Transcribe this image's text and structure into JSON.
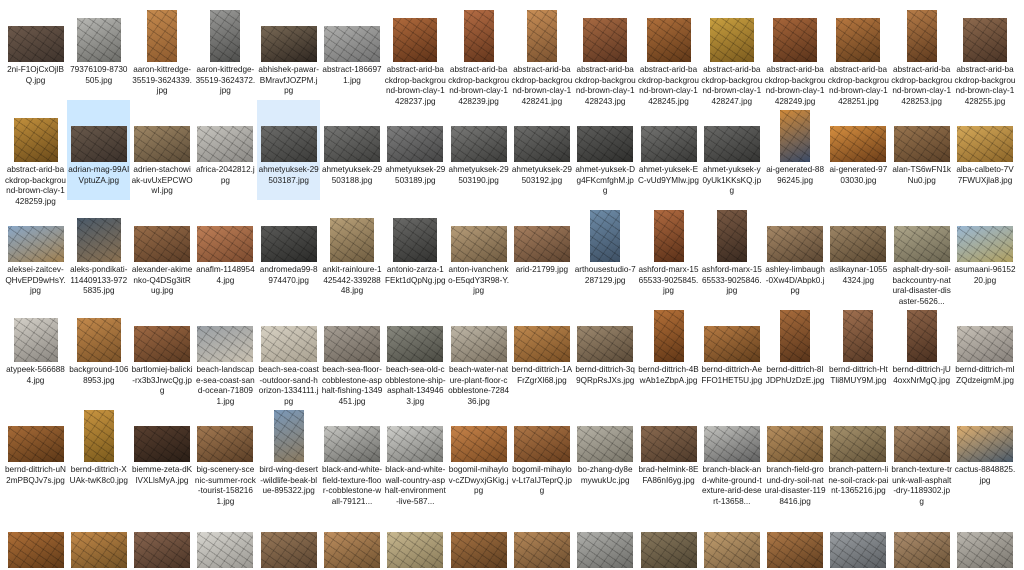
{
  "rows": [
    [
      {
        "label": "2ni-F1OjCxOjlBQ.jpg",
        "shape": "l",
        "c1": "#6e5a4c",
        "c2": "#3e332c"
      },
      {
        "label": "79376109-8730505.jpg",
        "shape": "s",
        "c1": "#b8b8b4",
        "c2": "#6c6c68"
      },
      {
        "label": "aaron-kittredge-35519-3624339.jpg",
        "shape": "p",
        "c1": "#c58a4e",
        "c2": "#8d5a2e"
      },
      {
        "label": "aaron-kittredge-35519-3624372.jpg",
        "shape": "p",
        "c1": "#9a9a98",
        "c2": "#4e4e4c"
      },
      {
        "label": "abhishek-pawar-BMravfJOZPM.jpg",
        "shape": "l",
        "c1": "#7a6a56",
        "c2": "#2e2620"
      },
      {
        "label": "abstract-1866971.jpg",
        "shape": "l",
        "c1": "#b0b0ae",
        "c2": "#707070"
      },
      {
        "label": "abstract-arid-backdrop-background-brown-clay-1428237.jpg",
        "shape": "s",
        "c1": "#b06a3c",
        "c2": "#5e3218"
      },
      {
        "label": "abstract-arid-backdrop-background-brown-clay-1428239.jpg",
        "shape": "p",
        "c1": "#b46c44",
        "c2": "#64361c"
      },
      {
        "label": "abstract-arid-backdrop-background-brown-clay-1428241.jpg",
        "shape": "p",
        "c1": "#c88e56",
        "c2": "#7a5230"
      },
      {
        "label": "abstract-arid-backdrop-background-brown-clay-1428243.jpg",
        "shape": "s",
        "c1": "#a86a42",
        "c2": "#5a3420"
      },
      {
        "label": "abstract-arid-backdrop-background-brown-clay-1428245.jpg",
        "shape": "s",
        "c1": "#b0703c",
        "c2": "#603818"
      },
      {
        "label": "abstract-arid-backdrop-background-brown-clay-1428247.jpg",
        "shape": "s",
        "c1": "#c9a040",
        "c2": "#7a5a1e"
      },
      {
        "label": "abstract-arid-backdrop-background-brown-clay-1428249.jpg",
        "shape": "s",
        "c1": "#a8663a",
        "c2": "#58321a"
      },
      {
        "label": "abstract-arid-backdrop-background-brown-clay-1428251.jpg",
        "shape": "s",
        "c1": "#b87840",
        "c2": "#603c1c"
      },
      {
        "label": "abstract-arid-backdrop-background-brown-clay-1428253.jpg",
        "shape": "p",
        "c1": "#b67c48",
        "c2": "#5e3a1e"
      },
      {
        "label": "abstract-arid-backdrop-background-brown-clay-1428255.jpg",
        "shape": "s",
        "c1": "#8e6a4e",
        "c2": "#4a3426"
      }
    ],
    [
      {
        "label": "abstract-arid-backdrop-background-brown-clay-1428259.jpg",
        "shape": "s",
        "c1": "#c2903c",
        "c2": "#6a4a1a"
      },
      {
        "label": "adrian-mag-99AIVptuZA.jpg",
        "shape": "l",
        "c1": "#6a5a4c",
        "c2": "#3a302a",
        "sel": "sel"
      },
      {
        "label": "adrien-stachowiak-uvUxEPCWOwI.jpg",
        "shape": "l",
        "c1": "#a08866",
        "c2": "#5a4a36"
      },
      {
        "label": "africa-2042812.jpg",
        "shape": "l",
        "c1": "#c8c6c0",
        "c2": "#8a8884"
      },
      {
        "label": "ahmetyuksek-29503187.jpg",
        "shape": "l",
        "c1": "#6c6c6a",
        "c2": "#3a3a38",
        "sel": "sel2"
      },
      {
        "label": "ahmetyuksek-29503188.jpg",
        "shape": "l",
        "c1": "#787876",
        "c2": "#3e3e3c"
      },
      {
        "label": "ahmetyuksek-29503189.jpg",
        "shape": "l",
        "c1": "#808080",
        "c2": "#444444"
      },
      {
        "label": "ahmetyuksek-29503190.jpg",
        "shape": "l",
        "c1": "#7a7a78",
        "c2": "#3c3c3a"
      },
      {
        "label": "ahmetyuksek-29503192.jpg",
        "shape": "l",
        "c1": "#6e6e6c",
        "c2": "#363634"
      },
      {
        "label": "ahmet-yuksek-Dg4FKcmfghM.jpg",
        "shape": "l",
        "c1": "#5e5e5c",
        "c2": "#2e2e2c"
      },
      {
        "label": "ahmet-yuksek-EC-vUd9YMIw.jpg",
        "shape": "l",
        "c1": "#747472",
        "c2": "#383836"
      },
      {
        "label": "ahmet-yuksek-y0yUk1KKsKQ.jpg",
        "shape": "l",
        "c1": "#6a6a68",
        "c2": "#343432"
      },
      {
        "label": "ai-generated-8896245.jpg",
        "shape": "p",
        "c1": "#d08a3a",
        "c2": "#3a4a66"
      },
      {
        "label": "ai-generated-9703030.jpg",
        "shape": "l",
        "c1": "#d89040",
        "c2": "#6a3c18"
      },
      {
        "label": "alan-TS6wFN1kNu0.jpg",
        "shape": "l",
        "c1": "#9a7650",
        "c2": "#5a4028"
      },
      {
        "label": "alba-calbeto-7V7FWUXjla8.jpg",
        "shape": "l",
        "c1": "#d6aa5a",
        "c2": "#8a6428"
      }
    ],
    [
      {
        "label": "aleksei-zaitcev-QHvEPD9wHsY.jpg",
        "shape": "l",
        "c1": "#8aa8c8",
        "c2": "#a08050"
      },
      {
        "label": "aleks-pondikati-114409133-9725835.jpg",
        "shape": "s",
        "c1": "#4a5a6a",
        "c2": "#8a7050"
      },
      {
        "label": "alexander-akimenko-Q4DSg3itRug.jpg",
        "shape": "l",
        "c1": "#9a6e4a",
        "c2": "#5a3c26"
      },
      {
        "label": "anaflm-11489544.jpg",
        "shape": "l",
        "c1": "#c08058",
        "c2": "#7a4a2e"
      },
      {
        "label": "andromeda99-8974470.jpg",
        "shape": "l",
        "c1": "#5a5a58",
        "c2": "#2a2a28"
      },
      {
        "label": "ankit-rainloure-1425442-33928848.jpg",
        "shape": "s",
        "c1": "#b8a078",
        "c2": "#6e5c40"
      },
      {
        "label": "antonio-zarza-1FEkt1dQpNg.jpg",
        "shape": "s",
        "c1": "#6a6a68",
        "c2": "#323230"
      },
      {
        "label": "anton-ivanchenko-E5qdY3R98-Y.jpg",
        "shape": "l",
        "c1": "#b89e7a",
        "c2": "#6e5a40"
      },
      {
        "label": "arid-21799.jpg",
        "shape": "l",
        "c1": "#a88060",
        "c2": "#5e4430"
      },
      {
        "label": "arthousestudio-7287129.jpg",
        "shape": "p",
        "c1": "#6e8ca8",
        "c2": "#3e5064"
      },
      {
        "label": "ashford-marx-1565533-9025845.jpg",
        "shape": "p",
        "c1": "#b06a40",
        "c2": "#5a3018"
      },
      {
        "label": "ashford-marx-1565533-9025846.jpg",
        "shape": "p",
        "c1": "#7a5a44",
        "c2": "#3a2a20"
      },
      {
        "label": "ashley-limbaugh-0Xw4D/Abpk0.jpg",
        "shape": "l",
        "c1": "#a88a68",
        "c2": "#5a4632"
      },
      {
        "label": "aslikaynar-10554324.jpg",
        "shape": "l",
        "c1": "#9e8666",
        "c2": "#584630"
      },
      {
        "label": "asphalt-dry-soil-backcountry-natural-disaster-disaster-5626...",
        "shape": "l",
        "c1": "#b0a88c",
        "c2": "#6a6450"
      },
      {
        "label": "asumaani-9615220.jpg",
        "shape": "l",
        "c1": "#9ab8d4",
        "c2": "#b0a060"
      }
    ],
    [
      {
        "label": "atypeek-5666884.jpg",
        "shape": "s",
        "c1": "#d4d0c8",
        "c2": "#8a8680"
      },
      {
        "label": "background-1068953.jpg",
        "shape": "s",
        "c1": "#c48a4c",
        "c2": "#7a5228"
      },
      {
        "label": "bartlomiej-balicki-rx3b3JrwcQg.jpg",
        "shape": "l",
        "c1": "#a06a44",
        "c2": "#5a3a22"
      },
      {
        "label": "beach-landscape-sea-coast-sand-ocean-718091.jpg",
        "shape": "l",
        "c1": "#9aa0a6",
        "c2": "#c8c0b0"
      },
      {
        "label": "beach-sea-coast-outdoor-sand-horizon-1334111.jpg",
        "shape": "l",
        "c1": "#d8d2c4",
        "c2": "#a8a090"
      },
      {
        "label": "beach-sea-floor-cobblestone-asphalt-fishing-1349451.jpg",
        "shape": "l",
        "c1": "#a8a096",
        "c2": "#6a6258"
      },
      {
        "label": "beach-sea-old-cobblestone-ship-asphalt-1349463.jpg",
        "shape": "l",
        "c1": "#8a8a80",
        "c2": "#4a4a42"
      },
      {
        "label": "beach-water-nature-plant-floor-cobblestone-728436.jpg",
        "shape": "l",
        "c1": "#c0b8a8",
        "c2": "#7a7060"
      },
      {
        "label": "bernd-dittrich-1AFrZgrXl68.jpg",
        "shape": "l",
        "c1": "#c08a50",
        "c2": "#784e24"
      },
      {
        "label": "bernd-dittrich-3q9QRpRsJXs.jpg",
        "shape": "l",
        "c1": "#9e8a70",
        "c2": "#5a4a38"
      },
      {
        "label": "bernd-dittrich-4BwAb1eZbpA.jpg",
        "shape": "p",
        "c1": "#b47038",
        "c2": "#603616"
      },
      {
        "label": "bernd-dittrich-AeFFO1HET5U.jpg",
        "shape": "l",
        "c1": "#b87c44",
        "c2": "#623e1c"
      },
      {
        "label": "bernd-dittrich-8IJDPhUzDzE.jpg",
        "shape": "p",
        "c1": "#a86c3c",
        "c2": "#58341a"
      },
      {
        "label": "bernd-dittrich-HtTli8MUY9M.jpg",
        "shape": "p",
        "c1": "#a07050",
        "c2": "#583a26"
      },
      {
        "label": "bernd-dittrich-jU4oxxNrMgQ.jpg",
        "shape": "p",
        "c1": "#8e6448",
        "c2": "#4a3020"
      },
      {
        "label": "bernd-dittrich-mIZQdzeigmM.jpg",
        "shape": "l",
        "c1": "#c8c2b8",
        "c2": "#86807a"
      }
    ],
    [
      {
        "label": "bernd-dittrich-uN2mPBQJv7s.jpg",
        "shape": "l",
        "c1": "#a86c38",
        "c2": "#5a3616"
      },
      {
        "label": "bernd-dittrich-XUAk-twK8c0.jpg",
        "shape": "p",
        "c1": "#c89440",
        "c2": "#7a5a1c"
      },
      {
        "label": "biemme-zeta-dKlVXLlsMyA.jpg",
        "shape": "l",
        "c1": "#5a4030",
        "c2": "#2a1e16"
      },
      {
        "label": "big-scenery-scenic-summer-rock-tourist-1582161.jpg",
        "shape": "l",
        "c1": "#a47a52",
        "c2": "#5a3e26"
      },
      {
        "label": "bird-wing-desert-wildlife-beak-blue-895322.jpg",
        "shape": "p",
        "c1": "#7a98b8",
        "c2": "#8a7a60"
      },
      {
        "label": "black-and-white-field-texture-floor-cobblestone-wall-79121...",
        "shape": "l",
        "c1": "#c8c8c4",
        "c2": "#6a6a66"
      },
      {
        "label": "black-and-white-wall-country-asphalt-environment-live-587...",
        "shape": "l",
        "c1": "#d0d0cc",
        "c2": "#7a7a76"
      },
      {
        "label": "bogomil-mihaylov-cZDwyxjGKig.jpg",
        "shape": "l",
        "c1": "#c8844a",
        "c2": "#7a4a22"
      },
      {
        "label": "bogomil-mihaylov-Lt7aIJTeprQ.jpg",
        "shape": "l",
        "c1": "#b07848",
        "c2": "#683e1e"
      },
      {
        "label": "bo-zhang-dy8emywukUc.jpg",
        "shape": "l",
        "c1": "#b8b4a8",
        "c2": "#787468"
      },
      {
        "label": "brad-helmink-8EFA86nI6yg.jpg",
        "shape": "l",
        "c1": "#8a6a50",
        "c2": "#4e3a2a"
      },
      {
        "label": "branch-black-and-white-ground-texture-arid-desert-13658...",
        "shape": "l",
        "c1": "#c4c4c0",
        "c2": "#606060"
      },
      {
        "label": "branch-field-ground-dry-soil-natural-disaster-1198416.jpg",
        "shape": "l",
        "c1": "#b89060",
        "c2": "#705430"
      },
      {
        "label": "branch-pattern-line-soil-crack-paint-1365216.jpg",
        "shape": "l",
        "c1": "#a8946e",
        "c2": "#625238"
      },
      {
        "label": "branch-texture-trunk-wall-asphalt-dry-1189302.jpg",
        "shape": "l",
        "c1": "#a88866",
        "c2": "#5e4630"
      },
      {
        "label": "cactus-8848825.jpg",
        "shape": "l",
        "c1": "#e0b070",
        "c2": "#4a5a6a"
      }
    ],
    [
      {
        "label": "",
        "shape": "l",
        "c1": "#b07038",
        "c2": "#603a18"
      },
      {
        "label": "",
        "shape": "l",
        "c1": "#c48a4a",
        "c2": "#705024"
      },
      {
        "label": "",
        "shape": "l",
        "c1": "#8a6650",
        "c2": "#4a3426"
      },
      {
        "label": "",
        "shape": "l",
        "c1": "#d8d6d0",
        "c2": "#9a9892"
      },
      {
        "label": "",
        "shape": "l",
        "c1": "#9a7a5a",
        "c2": "#5a4430"
      },
      {
        "label": "",
        "shape": "l",
        "c1": "#c09060",
        "c2": "#705230"
      },
      {
        "label": "",
        "shape": "l",
        "c1": "#c8b890",
        "c2": "#887a58"
      },
      {
        "label": "",
        "shape": "l",
        "c1": "#a87444",
        "c2": "#5e3e20"
      },
      {
        "label": "",
        "shape": "l",
        "c1": "#b88a5a",
        "c2": "#6a4c2e"
      },
      {
        "label": "",
        "shape": "l",
        "c1": "#b0b0ac",
        "c2": "#6c6c68"
      },
      {
        "label": "",
        "shape": "l",
        "c1": "#8a7a5e",
        "c2": "#4e4432"
      },
      {
        "label": "",
        "shape": "l",
        "c1": "#c4a070",
        "c2": "#7a6040"
      },
      {
        "label": "",
        "shape": "l",
        "c1": "#b07a48",
        "c2": "#603e20"
      },
      {
        "label": "",
        "shape": "l",
        "c1": "#9ca0a4",
        "c2": "#5a5e62"
      },
      {
        "label": "",
        "shape": "l",
        "c1": "#b09070",
        "c2": "#6a5236"
      },
      {
        "label": "",
        "shape": "l",
        "c1": "#bcb8b0",
        "c2": "#7a766e"
      }
    ]
  ]
}
